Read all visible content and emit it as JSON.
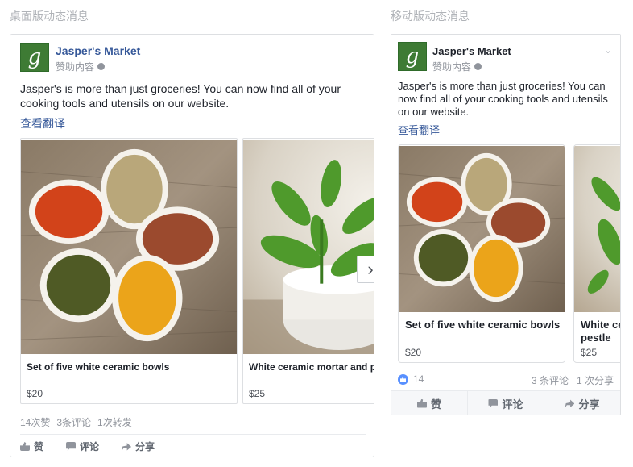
{
  "labels": {
    "desktop": "桌面版动态消息",
    "mobile": "移动版动态消息"
  },
  "page": {
    "name": "Jasper's Market",
    "sponsored": "赞助内容",
    "avatar_letter": "g"
  },
  "post": {
    "text": "Jasper's is more than just groceries! You can now find all of your cooking tools and utensils on our website.",
    "translate": "查看翻译"
  },
  "desktop": {
    "carousel": [
      {
        "title": "Set of five white ceramic bowls",
        "price": "$20"
      },
      {
        "title": "White ceramic mortar and pestle",
        "price": "$25"
      }
    ],
    "stats": {
      "likes": "14次赞",
      "comments": "3条评论",
      "shares": "1次转发"
    },
    "actions": {
      "like": "赞",
      "comment": "评论",
      "share": "分享"
    }
  },
  "mobile": {
    "carousel": [
      {
        "title": "Set of five white ceramic bowls",
        "price": "$20"
      },
      {
        "title": "White ceramic mortar and pestle",
        "price": "$25"
      }
    ],
    "reactions": {
      "likes": "14",
      "comments": "3 条评论",
      "shares": "1 次分享"
    },
    "actions": {
      "like": "赞",
      "comment": "评论",
      "share": "分享"
    }
  },
  "icons": [
    "globe-icon",
    "chevron-right-icon",
    "chevron-down-icon",
    "like-icon",
    "comment-icon",
    "share-icon"
  ],
  "colors": {
    "link": "#365899",
    "brand_green": "#3e7b34",
    "like_blue": "#5890ff",
    "muted": "#90949c"
  }
}
